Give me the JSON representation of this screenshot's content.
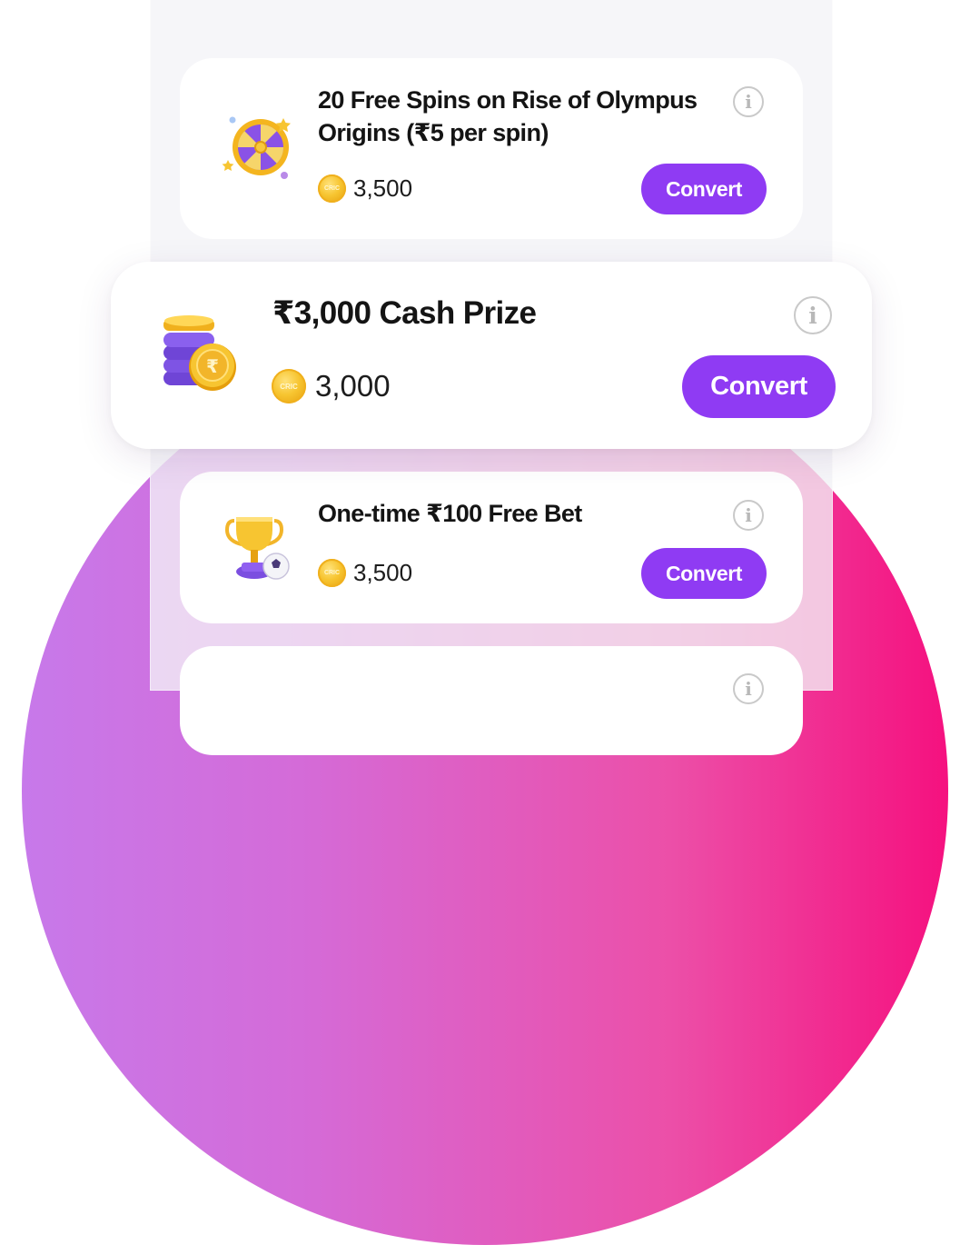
{
  "offers": [
    {
      "title": "20 Free Spins on Rise of Olympus Origins (₹5 per spin)",
      "price": "3,500",
      "coin_label": "CRIC",
      "button_label": "Convert",
      "thumb_icon": "prize-wheel-icon"
    },
    {
      "title": "₹3,000 Cash Prize",
      "price": "3,000",
      "coin_label": "CRIC",
      "button_label": "Convert",
      "thumb_icon": "rupee-coin-stack-icon"
    },
    {
      "title": "One-time ₹100 Free Bet",
      "price": "3,500",
      "coin_label": "CRIC",
      "button_label": "Convert",
      "thumb_icon": "trophy-football-icon"
    }
  ],
  "info_glyph": "i",
  "rupee_glyph": "₹",
  "colors": {
    "accent": "#8f3bf3",
    "gradient_start": "#c779ea",
    "gradient_end": "#f5117f",
    "coin": "#f7c531"
  }
}
